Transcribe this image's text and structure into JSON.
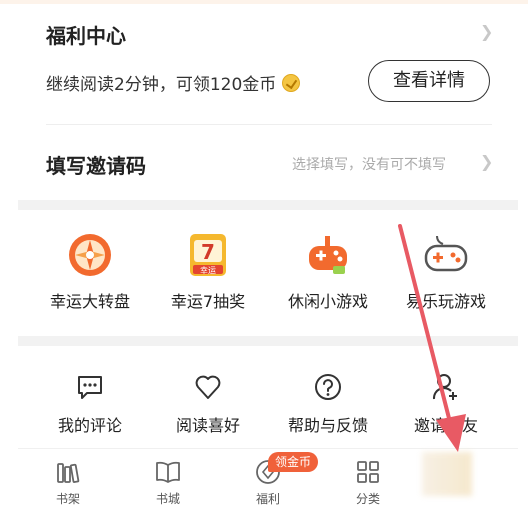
{
  "welfare": {
    "title": "福利中心",
    "subtitle": "继续阅读2分钟，可领120金币",
    "button": "查看详情"
  },
  "invite": {
    "title": "填写邀请码",
    "hint": "选择填写，没有可不填写"
  },
  "games": [
    {
      "label": "幸运大转盘",
      "icon": "wheel-icon"
    },
    {
      "label": "幸运7抽奖",
      "icon": "lucky7-icon",
      "badge_text": "幸运",
      "digit": "7"
    },
    {
      "label": "休闲小游戏",
      "icon": "gamepad-icon"
    },
    {
      "label": "易乐玩游戏",
      "icon": "controller-icon"
    }
  ],
  "tools": [
    {
      "label": "我的评论",
      "icon": "comment-icon"
    },
    {
      "label": "阅读喜好",
      "icon": "heart-icon"
    },
    {
      "label": "帮助与反馈",
      "icon": "help-icon"
    },
    {
      "label": "邀请好友",
      "icon": "add-friend-icon"
    }
  ],
  "tabs": [
    {
      "label": "书架",
      "icon": "bookshelf-icon"
    },
    {
      "label": "书城",
      "icon": "book-icon"
    },
    {
      "label": "福利",
      "icon": "welfare-icon",
      "badge": "领金币"
    },
    {
      "label": "分类",
      "icon": "category-icon"
    }
  ],
  "colors": {
    "accent_orange": "#f0613a",
    "arrow_red": "#e85a64",
    "coin_gold": "#f4c542"
  }
}
